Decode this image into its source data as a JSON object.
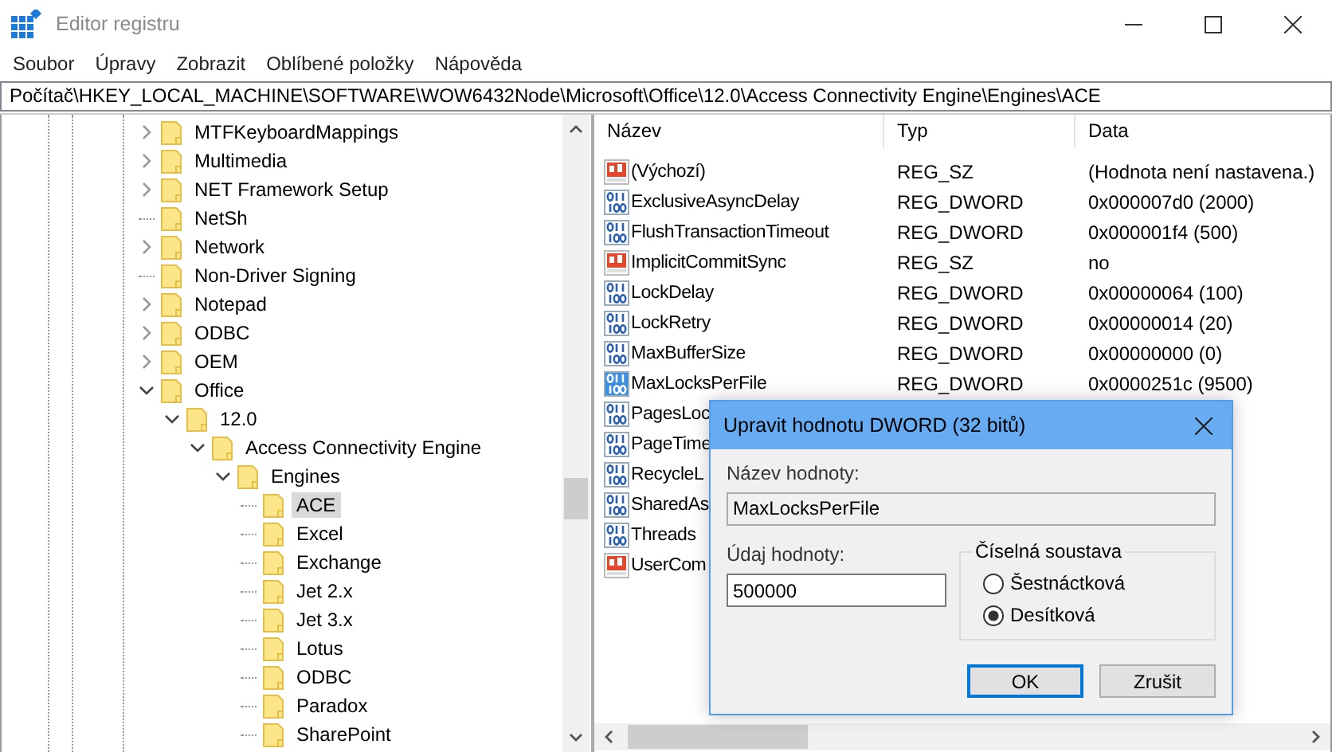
{
  "window": {
    "title": "Editor registru"
  },
  "menu": [
    "Soubor",
    "Úpravy",
    "Zobrazit",
    "Oblíbené položky",
    "Nápověda"
  ],
  "address": "Počítač\\HKEY_LOCAL_MACHINE\\SOFTWARE\\WOW6432Node\\Microsoft\\Office\\12.0\\Access Connectivity Engine\\Engines\\ACE",
  "tree": [
    {
      "label": "MTFKeyboardMappings",
      "expanded": false,
      "selected": false
    },
    {
      "label": "Multimedia",
      "expanded": false,
      "selected": false
    },
    {
      "label": "NET Framework Setup",
      "expanded": false,
      "selected": false
    },
    {
      "label": "NetSh",
      "selected": false
    },
    {
      "label": "Network",
      "expanded": false,
      "selected": false
    },
    {
      "label": "Non-Driver Signing",
      "selected": false
    },
    {
      "label": "Notepad",
      "expanded": false,
      "selected": false
    },
    {
      "label": "ODBC",
      "expanded": false,
      "selected": false
    },
    {
      "label": "OEM",
      "expanded": false,
      "selected": false
    },
    {
      "label": "Office",
      "expanded": true,
      "selected": false,
      "children": [
        {
          "label": "12.0",
          "expanded": true,
          "selected": false,
          "children": [
            {
              "label": "Access Connectivity Engine",
              "expanded": true,
              "selected": false,
              "children": [
                {
                  "label": "Engines",
                  "expanded": true,
                  "selected": false,
                  "children": [
                    {
                      "label": "ACE",
                      "selected": true
                    },
                    {
                      "label": "Excel",
                      "selected": false
                    },
                    {
                      "label": "Exchange",
                      "selected": false
                    },
                    {
                      "label": "Jet 2.x",
                      "selected": false
                    },
                    {
                      "label": "Jet 3.x",
                      "selected": false
                    },
                    {
                      "label": "Lotus",
                      "selected": false
                    },
                    {
                      "label": "ODBC",
                      "selected": false
                    },
                    {
                      "label": "Paradox",
                      "selected": false
                    },
                    {
                      "label": "SharePoint",
                      "selected": false
                    }
                  ]
                }
              ]
            }
          ]
        }
      ]
    }
  ],
  "list": {
    "columns": [
      "Název",
      "Typ",
      "Data"
    ],
    "rows": [
      {
        "kind": "string",
        "name": "(Výchozí)",
        "type": "REG_SZ",
        "data": "(Hodnota není nastavena.)",
        "selected": false
      },
      {
        "kind": "dword",
        "name": "ExclusiveAsyncDelay",
        "type": "REG_DWORD",
        "data": "0x000007d0 (2000)",
        "selected": false
      },
      {
        "kind": "dword",
        "name": "FlushTransactionTimeout",
        "type": "REG_DWORD",
        "data": "0x000001f4 (500)",
        "selected": false
      },
      {
        "kind": "string",
        "name": "ImplicitCommitSync",
        "type": "REG_SZ",
        "data": "no",
        "selected": false
      },
      {
        "kind": "dword",
        "name": "LockDelay",
        "type": "REG_DWORD",
        "data": "0x00000064 (100)",
        "selected": false
      },
      {
        "kind": "dword",
        "name": "LockRetry",
        "type": "REG_DWORD",
        "data": "0x00000014 (20)",
        "selected": false
      },
      {
        "kind": "dword",
        "name": "MaxBufferSize",
        "type": "REG_DWORD",
        "data": "0x00000000 (0)",
        "selected": false
      },
      {
        "kind": "dword",
        "name": "MaxLocksPerFile",
        "type": "REG_DWORD",
        "data": "0x0000251c (9500)",
        "selected": true
      },
      {
        "kind": "dword",
        "name": "PagesLoc",
        "selected": false
      },
      {
        "kind": "dword",
        "name": "PageTime",
        "selected": false
      },
      {
        "kind": "dword",
        "name": "RecycleL",
        "selected": false
      },
      {
        "kind": "dword",
        "name": "SharedAs",
        "selected": false
      },
      {
        "kind": "dword",
        "name": "Threads",
        "selected": false
      },
      {
        "kind": "string",
        "name": "UserCom",
        "selected": false
      }
    ]
  },
  "dialog": {
    "title": "Upravit hodnotu DWORD (32 bitů)",
    "name_label": "Název hodnoty:",
    "name_value": "MaxLocksPerFile",
    "data_label": "Údaj hodnoty:",
    "data_value": "500000",
    "base_group": {
      "label": "Číselná soustava",
      "options": [
        {
          "label": "Šestnáctková",
          "selected": false
        },
        {
          "label": "Desítková",
          "selected": true
        }
      ]
    },
    "buttons": [
      {
        "label": "OK",
        "default": true
      },
      {
        "label": "Zrušit",
        "default": false
      }
    ]
  }
}
